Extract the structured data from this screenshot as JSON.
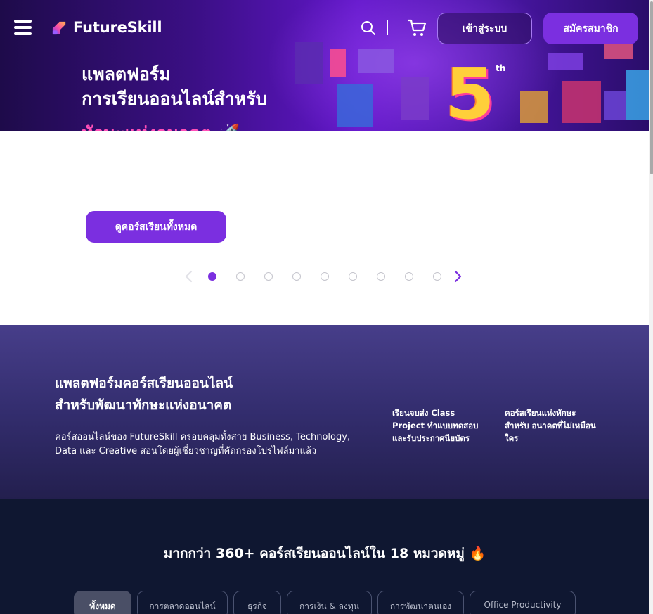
{
  "header": {
    "logo_text_a": "Future",
    "logo_text_b": "Skill",
    "login_label": "เข้าสู่ระบบ",
    "signup_label": "สมัครสมาชิก",
    "icons": [
      "menu-icon",
      "search-icon",
      "cart-icon"
    ]
  },
  "hero": {
    "line1": "แพลตฟอร์ม",
    "line2": "การเรียนออนไลน์สำหรับ",
    "line3": "ทักษะแห่งอนาคต 🚀",
    "anniversary_number": "5",
    "anniversary_suffix": "th"
  },
  "carousel": {
    "cta_label": "ดูคอร์สเรียนทั้งหมด",
    "total_slides": 9,
    "active_index": 0
  },
  "info": {
    "title_line1": "แพลตฟอร์มคอร์สเรียนออนไลน์",
    "title_line2": "สำหรับพัฒนาทักษะแห่งอนาคต",
    "desc_line1": "คอร์สออนไลน์ของ FutureSkill ครอบคลุมทั้งสาย Business, Technology,",
    "desc_line2": "Data และ Creative สอนโดยผู้เชี่ยวชาญที่คัดกรองโปรไฟล์มาแล้ว",
    "features": [
      "เรียนจบส่ง Class Project ทำแบบทดสอบ และรับประกาศนียบัตร",
      "คอร์สเรียนแห่งทักษะ สำหรับ อนาคตที่ไม่เหมือนใคร"
    ]
  },
  "categories": {
    "title": "มากกว่า 360+ คอร์สเรียนออนไลน์ใน 18 หมวดหมู่ 🔥",
    "tabs": [
      {
        "label": "ทั้งหมด",
        "active": true
      },
      {
        "label": "การตลาดออนไลน์",
        "active": false
      },
      {
        "label": "ธุรกิจ",
        "active": false
      },
      {
        "label": "การเงิน & ลงทุน",
        "active": false
      },
      {
        "label": "การพัฒนาตนเอง",
        "active": false
      },
      {
        "label": "Office Productivity",
        "active": false
      }
    ]
  },
  "colors": {
    "brand_purple": "#7b2fe0",
    "dark_navy": "#0f1731",
    "info_band": "#332d6e"
  }
}
